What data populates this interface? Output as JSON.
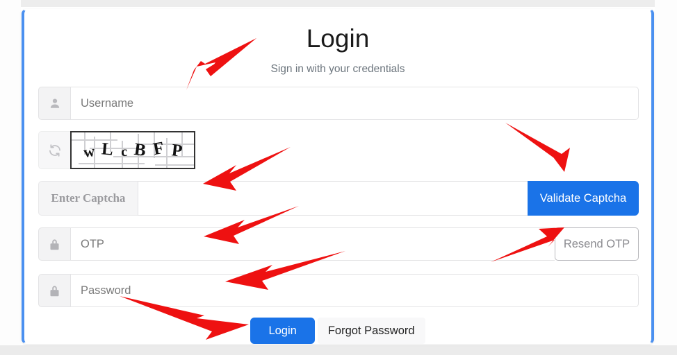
{
  "card": {
    "title": "Login",
    "subtitle": "Sign in with your credentials",
    "border_color": "#4a90f0"
  },
  "fields": {
    "username": {
      "icon": "user-icon",
      "placeholder": "Username",
      "value": ""
    },
    "captcha_image": {
      "icon": "refresh-icon",
      "letters": [
        "w",
        "L",
        "c",
        "B",
        "F",
        "P"
      ],
      "text": "wLcBFP"
    },
    "captcha_answer": {
      "label": "Enter Captcha",
      "placeholder": "",
      "value": ""
    },
    "otp": {
      "icon": "lock-icon",
      "placeholder": "OTP",
      "value": ""
    },
    "password": {
      "icon": "lock-icon",
      "placeholder": "Password",
      "value": ""
    }
  },
  "buttons": {
    "validate_captcha": "Validate Captcha",
    "resend_otp": "Resend OTP",
    "login": "Login",
    "forgot_password": "Forgot Password"
  },
  "colors": {
    "primary_blue": "#1a73e8",
    "card_border_blue": "#4a90f0",
    "annotation_red": "#ee1111",
    "muted_text": "#6c757d"
  },
  "annotations": {
    "arrow_color": "#ee1111",
    "arrow_count": 6,
    "arrows": [
      {
        "name": "arrow-to-username",
        "points_to": "username-input"
      },
      {
        "name": "arrow-to-captcha-answer",
        "points_to": "captcha-answer-input"
      },
      {
        "name": "arrow-to-validate-captcha",
        "points_to": "validate-captcha-button"
      },
      {
        "name": "arrow-to-otp",
        "points_to": "otp-input"
      },
      {
        "name": "arrow-to-resend-otp",
        "points_to": "resend-otp-button"
      },
      {
        "name": "arrow-to-password",
        "points_to": "password-input"
      },
      {
        "name": "arrow-to-login",
        "points_to": "login-button"
      }
    ]
  }
}
